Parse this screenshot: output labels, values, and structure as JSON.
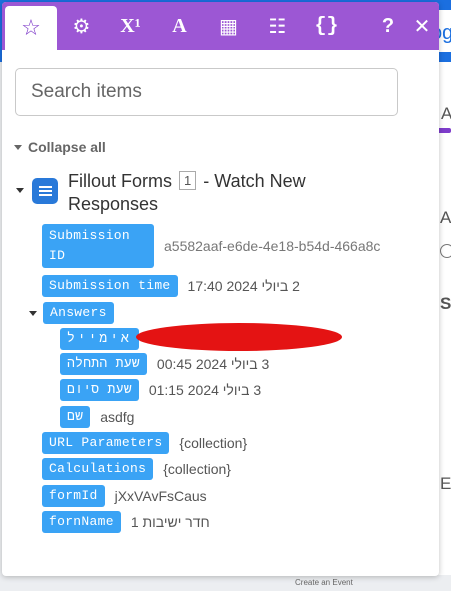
{
  "background": {
    "button_label": "og",
    "side_letters": [
      "A",
      "A",
      "S",
      "Er"
    ],
    "status_text": "Create an Event"
  },
  "tabs": [
    {
      "icon": "star-icon",
      "glyph": "☆"
    },
    {
      "icon": "gear-icon",
      "glyph": "⚙"
    },
    {
      "icon": "superscript-icon",
      "glyph": "X¹"
    },
    {
      "icon": "text-icon",
      "glyph": "A"
    },
    {
      "icon": "calendar-icon",
      "glyph": "▦"
    },
    {
      "icon": "table-icon",
      "glyph": "☷"
    },
    {
      "icon": "braces-icon",
      "glyph": "{}"
    },
    {
      "icon": "help-icon",
      "glyph": "?"
    },
    {
      "icon": "close-icon",
      "glyph": "✕"
    }
  ],
  "search": {
    "placeholder": "Search items"
  },
  "collapse_label": "Collapse all",
  "module": {
    "title": "Fillout Forms",
    "badge": "1",
    "subtitle": "- Watch New Responses"
  },
  "fields": {
    "submission_id": {
      "label": "Submission ID",
      "value": "a5582aaf-e6de-4e18-b54d-466a8c"
    },
    "submission_time": {
      "label": "Submission time",
      "value": "2 ביולי 2024 17:40"
    },
    "answers": {
      "label": "Answers"
    },
    "email": {
      "label": "אימייל"
    },
    "start_time": {
      "label": "שעת התחלה",
      "value": "3 ביולי 2024 00:45"
    },
    "end_time": {
      "label": "שעת סיום",
      "value": "3 ביולי 2024 01:15"
    },
    "name": {
      "label": "שם",
      "value": "asdfg"
    },
    "url_parameters": {
      "label": "URL Parameters",
      "value": "{collection}"
    },
    "calculations": {
      "label": "Calculations",
      "value": "{collection}"
    },
    "form_id": {
      "label": "formId",
      "value": "jXxVAvFsCaus"
    },
    "form_name": {
      "label": "fornName",
      "value": "חדר ישיבות 1"
    }
  }
}
